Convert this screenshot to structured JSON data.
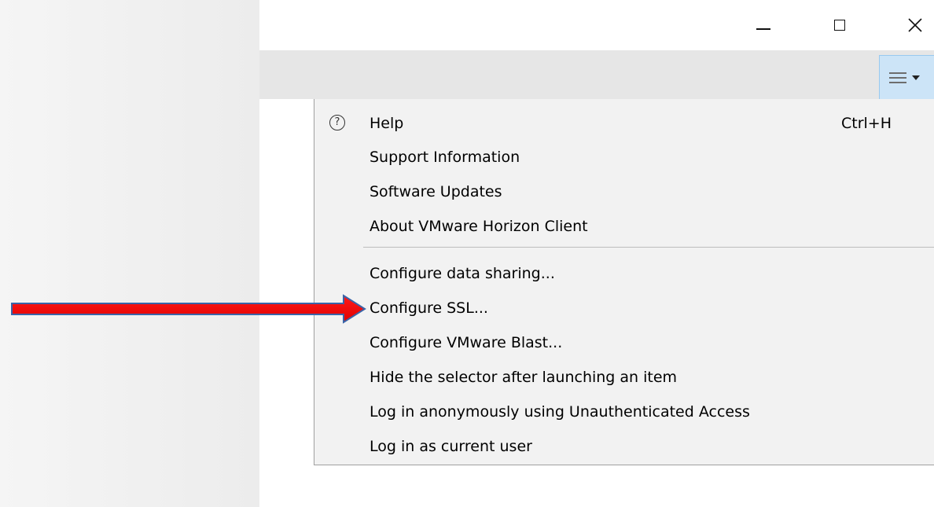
{
  "window": {
    "controls": {
      "minimize": "minimize",
      "maximize": "maximize",
      "close": "close"
    }
  },
  "toolbar": {
    "menu_button_icon": "hamburger-menu-icon"
  },
  "menu": {
    "help": {
      "label": "Help",
      "shortcut": "Ctrl+H",
      "icon": "?"
    },
    "items_group1": [
      "Support Information",
      "Software Updates",
      "About VMware Horizon Client"
    ],
    "items_group2": [
      "Configure data sharing...",
      "Configure SSL...",
      "Configure VMware Blast...",
      "Hide the selector after launching an item",
      "Log in anonymously using Unauthenticated Access",
      "Log in as current user"
    ]
  },
  "annotation": {
    "arrow_color": "#ff0000",
    "points_to": "Configure SSL..."
  },
  "colors": {
    "toolbar_bg": "#e6e6e6",
    "menu_bg": "#f2f2f2",
    "menu_button_active": "#cce4f7"
  }
}
